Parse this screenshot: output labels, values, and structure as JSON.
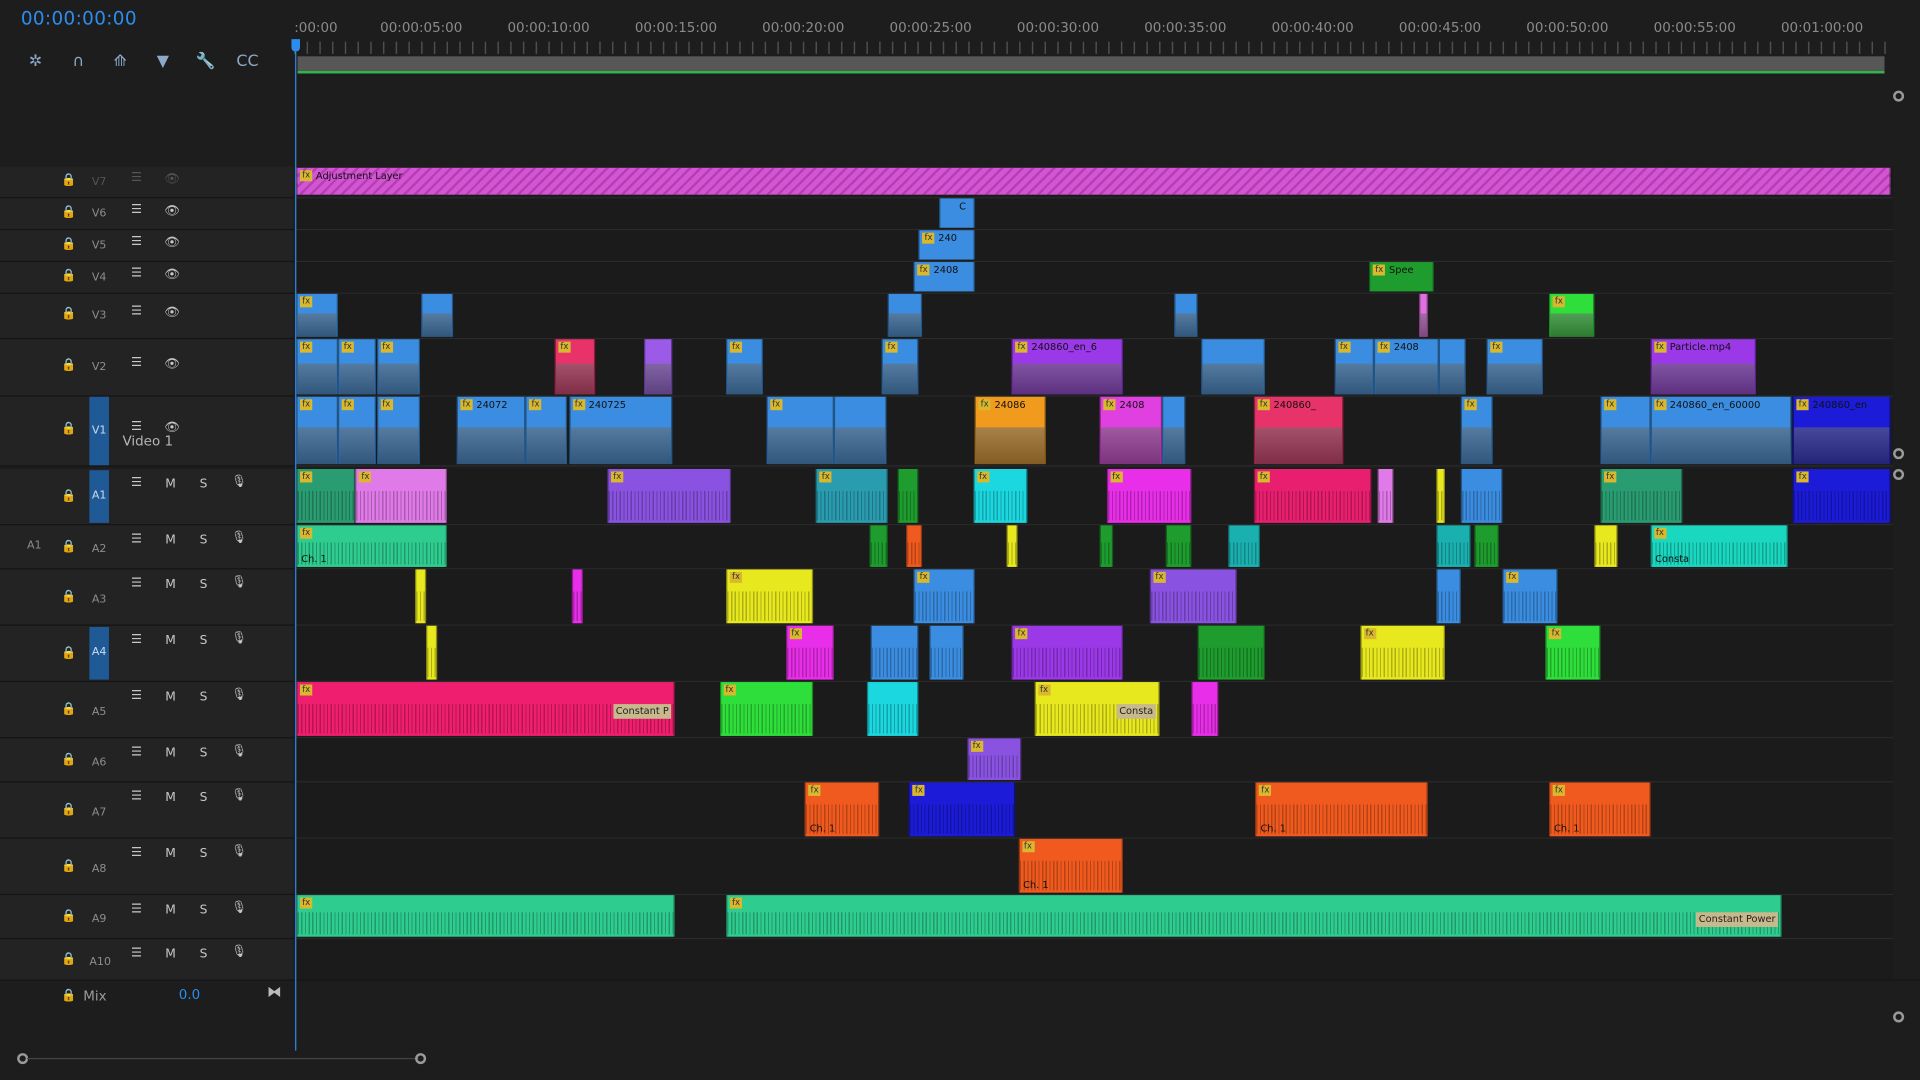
{
  "timecode": "00:00:00:00",
  "tools": [
    {
      "name": "snap-icon",
      "glyph": "✲"
    },
    {
      "name": "magnet-icon",
      "glyph": "∩"
    },
    {
      "name": "linked-selection-icon",
      "glyph": "⟰"
    },
    {
      "name": "marker-icon",
      "glyph": "▼"
    },
    {
      "name": "wrench-icon",
      "glyph": "🔧"
    },
    {
      "name": "captions-icon",
      "glyph": "CC"
    }
  ],
  "ruler_labels": [
    ":00:00",
    "00:00:05:00",
    "00:00:10:00",
    "00:00:15:00",
    "00:00:20:00",
    "00:00:25:00",
    "00:00:30:00",
    "00:00:35:00",
    "00:00:40:00",
    "00:00:45:00",
    "00:00:50:00",
    "00:00:55:00",
    "00:01:00:00"
  ],
  "video_tracks": [
    {
      "id": "V7",
      "label": "",
      "target": false
    },
    {
      "id": "V6",
      "label": "",
      "target": false
    },
    {
      "id": "V5",
      "label": "",
      "target": false
    },
    {
      "id": "V4",
      "label": "",
      "target": false
    },
    {
      "id": "V3",
      "label": "",
      "target": false
    },
    {
      "id": "V2",
      "label": "",
      "target": false
    },
    {
      "id": "V1",
      "label": "Video 1",
      "target": true
    }
  ],
  "audio_tracks": [
    {
      "id": "A1",
      "source": "",
      "target": true
    },
    {
      "id": "A2",
      "source": "A1",
      "target": false
    },
    {
      "id": "A3",
      "source": "",
      "target": false
    },
    {
      "id": "A4",
      "source": "",
      "target": true
    },
    {
      "id": "A5",
      "source": "",
      "target": false
    },
    {
      "id": "A6",
      "source": "",
      "target": false
    },
    {
      "id": "A7",
      "source": "",
      "target": false
    },
    {
      "id": "A8",
      "source": "",
      "target": false
    },
    {
      "id": "A9",
      "source": "",
      "target": false
    },
    {
      "id": "A10",
      "source": "",
      "target": false
    }
  ],
  "mix": {
    "label": "Mix",
    "value": "0.0"
  },
  "header_glyphs": {
    "mute": "M",
    "solo": "S",
    "eye": "👁",
    "sync": "☰",
    "mic": "🎙",
    "lock": "🔒"
  },
  "clips": [
    {
      "track": "V7",
      "start": 0.0,
      "end": 99.4,
      "color": "#d455d4",
      "label": "Adjustment Layer",
      "fx": true,
      "hatched": true
    },
    {
      "track": "V6",
      "start": 40.1,
      "end": 42.3,
      "color": "#3a8de0",
      "label": "C",
      "fx": false
    },
    {
      "track": "V5",
      "start": 38.8,
      "end": 42.3,
      "color": "#3a8de0",
      "label": "240",
      "fx": true
    },
    {
      "track": "V4",
      "start": 38.5,
      "end": 42.3,
      "color": "#3a8de0",
      "label": "2408",
      "fx": true
    },
    {
      "track": "V4",
      "start": 66.9,
      "end": 70.9,
      "color": "#1e9c2d",
      "label": "Spee",
      "fx": true
    },
    {
      "track": "V3",
      "start": 0.0,
      "end": 2.6,
      "color": "#3a8de0",
      "label": "",
      "fx": true
    },
    {
      "track": "V3",
      "start": 7.8,
      "end": 9.8,
      "color": "#3a8de0",
      "label": "",
      "fx": false
    },
    {
      "track": "V3",
      "start": 36.9,
      "end": 39.0,
      "color": "#3a8de0",
      "label": "",
      "fx": false
    },
    {
      "track": "V3",
      "start": 54.7,
      "end": 56.2,
      "color": "#3a8de0",
      "label": "",
      "fx": false
    },
    {
      "track": "V3",
      "start": 70.0,
      "end": 70.5,
      "color": "#e070e0",
      "label": "",
      "fx": false
    },
    {
      "track": "V3",
      "start": 78.1,
      "end": 80.9,
      "color": "#2ede3a",
      "label": "",
      "fx": true
    },
    {
      "track": "V2",
      "start": 0.0,
      "end": 2.6,
      "color": "#3a8de0",
      "label": "",
      "fx": true
    },
    {
      "track": "V2",
      "start": 2.6,
      "end": 5.0,
      "color": "#3a8de0",
      "label": "",
      "fx": true
    },
    {
      "track": "V2",
      "start": 5.0,
      "end": 7.7,
      "color": "#3a8de0",
      "label": "",
      "fx": true
    },
    {
      "track": "V2",
      "start": 16.1,
      "end": 18.6,
      "color": "#e8336a",
      "label": "",
      "fx": true
    },
    {
      "track": "V2",
      "start": 21.7,
      "end": 23.4,
      "color": "#9b5be8",
      "label": "",
      "fx": false
    },
    {
      "track": "V2",
      "start": 26.8,
      "end": 29.1,
      "color": "#3a8de0",
      "label": "",
      "fx": true
    },
    {
      "track": "V2",
      "start": 36.5,
      "end": 38.8,
      "color": "#3a8de0",
      "label": "",
      "fx": true
    },
    {
      "track": "V2",
      "start": 44.6,
      "end": 51.5,
      "color": "#9b38e8",
      "label": "240860_en_6",
      "fx": true
    },
    {
      "track": "V2",
      "start": 56.4,
      "end": 60.4,
      "color": "#3a8de0",
      "label": "",
      "fx": false
    },
    {
      "track": "V2",
      "start": 64.7,
      "end": 67.2,
      "color": "#3a8de0",
      "label": "",
      "fx": true
    },
    {
      "track": "V2",
      "start": 67.2,
      "end": 71.2,
      "color": "#3a8de0",
      "label": "2408",
      "fx": true
    },
    {
      "track": "V2",
      "start": 71.2,
      "end": 72.9,
      "color": "#3a8de0",
      "label": "",
      "fx": false
    },
    {
      "track": "V2",
      "start": 74.2,
      "end": 77.7,
      "color": "#3a8de0",
      "label": "",
      "fx": true
    },
    {
      "track": "V2",
      "start": 84.4,
      "end": 91.0,
      "color": "#9b38e8",
      "label": "Particle.mp4",
      "fx": true
    },
    {
      "track": "V1",
      "start": 0.0,
      "end": 2.6,
      "color": "#3a8de0",
      "label": "",
      "fx": true
    },
    {
      "track": "V1",
      "start": 2.6,
      "end": 5.0,
      "color": "#3a8de0",
      "label": "",
      "fx": true
    },
    {
      "track": "V1",
      "start": 5.0,
      "end": 7.7,
      "color": "#3a8de0",
      "label": "",
      "fx": true
    },
    {
      "track": "V1",
      "start": 10.0,
      "end": 14.3,
      "color": "#3a8de0",
      "label": "24072",
      "fx": true
    },
    {
      "track": "V1",
      "start": 14.3,
      "end": 16.9,
      "color": "#3a8de0",
      "label": "",
      "fx": true
    },
    {
      "track": "V1",
      "start": 17.0,
      "end": 23.4,
      "color": "#3a8de0",
      "label": "240725",
      "fx": true
    },
    {
      "track": "V1",
      "start": 29.3,
      "end": 33.5,
      "color": "#3a8de0",
      "label": "",
      "fx": true
    },
    {
      "track": "V1",
      "start": 33.5,
      "end": 36.8,
      "color": "#3a8de0",
      "label": "",
      "fx": false
    },
    {
      "track": "V1",
      "start": 42.3,
      "end": 46.7,
      "color": "#f09b1d",
      "label": "24086",
      "fx": true
    },
    {
      "track": "V1",
      "start": 50.1,
      "end": 54.0,
      "color": "#e040e0",
      "label": "2408",
      "fx": true
    },
    {
      "track": "V1",
      "start": 54.0,
      "end": 55.4,
      "color": "#3a8de0",
      "label": "",
      "fx": false
    },
    {
      "track": "V1",
      "start": 59.7,
      "end": 65.3,
      "color": "#e8336a",
      "label": "240860_",
      "fx": true
    },
    {
      "track": "V1",
      "start": 72.6,
      "end": 74.6,
      "color": "#3a8de0",
      "label": "",
      "fx": true
    },
    {
      "track": "V1",
      "start": 81.3,
      "end": 84.4,
      "color": "#3a8de0",
      "label": "",
      "fx": true
    },
    {
      "track": "V1",
      "start": 84.4,
      "end": 93.2,
      "color": "#3a8de0",
      "label": "240860_en_60000",
      "fx": true
    },
    {
      "track": "V1",
      "start": 93.3,
      "end": 99.4,
      "color": "#1b1bd8",
      "label": "240860_en",
      "fx": true
    },
    {
      "track": "A1",
      "start": 0.0,
      "end": 3.7,
      "color": "#2a9c72",
      "label": "",
      "fx": true
    },
    {
      "track": "A1",
      "start": 3.7,
      "end": 9.4,
      "color": "#e07ae8",
      "label": "",
      "fx": true
    },
    {
      "track": "A1",
      "start": 19.4,
      "end": 27.1,
      "color": "#8a52e0",
      "label": "",
      "fx": true
    },
    {
      "track": "A1",
      "start": 32.4,
      "end": 36.9,
      "color": "#2a9cb0",
      "label": "",
      "fx": true
    },
    {
      "track": "A1",
      "start": 37.5,
      "end": 38.8,
      "color": "#1e9c2d",
      "label": "",
      "fx": false
    },
    {
      "track": "A1",
      "start": 42.2,
      "end": 45.6,
      "color": "#1ad7e0",
      "label": "",
      "fx": true
    },
    {
      "track": "A1",
      "start": 50.5,
      "end": 55.8,
      "color": "#e82ee8",
      "label": "",
      "fx": true
    },
    {
      "track": "A1",
      "start": 59.7,
      "end": 67.0,
      "color": "#e81e6e",
      "label": "",
      "fx": true
    },
    {
      "track": "A1",
      "start": 67.4,
      "end": 68.4,
      "color": "#e07ae8",
      "label": "",
      "fx": false
    },
    {
      "track": "A1",
      "start": 71.1,
      "end": 71.6,
      "color": "#e8e81e",
      "label": "",
      "fx": false
    },
    {
      "track": "A1",
      "start": 72.6,
      "end": 75.2,
      "color": "#3a8de0",
      "label": "",
      "fx": false
    },
    {
      "track": "A1",
      "start": 81.3,
      "end": 86.4,
      "color": "#2a9c72",
      "label": "",
      "fx": true
    },
    {
      "track": "A1",
      "start": 93.3,
      "end": 99.4,
      "color": "#1b1bd8",
      "label": "",
      "fx": true
    },
    {
      "track": "A2",
      "start": 0.0,
      "end": 9.4,
      "color": "#2ecc8e",
      "label": "Ch. 1",
      "fx": true
    },
    {
      "track": "A2",
      "start": 35.7,
      "end": 36.9,
      "color": "#1e9c2d",
      "label": "",
      "fx": false
    },
    {
      "track": "A2",
      "start": 38.0,
      "end": 39.0,
      "color": "#f05a1e",
      "label": "",
      "fx": false
    },
    {
      "track": "A2",
      "start": 44.3,
      "end": 45.0,
      "color": "#e8e81e",
      "label": "",
      "fx": false
    },
    {
      "track": "A2",
      "start": 50.1,
      "end": 50.9,
      "color": "#1e9c2d",
      "label": "",
      "fx": false
    },
    {
      "track": "A2",
      "start": 54.2,
      "end": 55.8,
      "color": "#1e9c2d",
      "label": "",
      "fx": false
    },
    {
      "track": "A2",
      "start": 58.1,
      "end": 60.1,
      "color": "#1ab0b0",
      "label": "",
      "fx": false
    },
    {
      "track": "A2",
      "start": 71.1,
      "end": 73.2,
      "color": "#1ab0b0",
      "label": "",
      "fx": false
    },
    {
      "track": "A2",
      "start": 73.4,
      "end": 75.0,
      "color": "#1e9c2d",
      "label": "",
      "fx": false
    },
    {
      "track": "A2",
      "start": 80.9,
      "end": 82.4,
      "color": "#e8e81e",
      "label": "",
      "fx": false
    },
    {
      "track": "A2",
      "start": 84.4,
      "end": 93.0,
      "color": "#1ad7c0",
      "label": "Consta",
      "fx": true
    },
    {
      "track": "A3",
      "start": 7.4,
      "end": 8.1,
      "color": "#e8e81e",
      "label": "",
      "fx": false
    },
    {
      "track": "A3",
      "start": 17.2,
      "end": 17.9,
      "color": "#e82ee8",
      "label": "",
      "fx": false
    },
    {
      "track": "A3",
      "start": 26.8,
      "end": 32.2,
      "color": "#e8e81e",
      "label": "",
      "fx": true
    },
    {
      "track": "A3",
      "start": 38.5,
      "end": 42.3,
      "color": "#3a8de0",
      "label": "",
      "fx": true
    },
    {
      "track": "A3",
      "start": 53.2,
      "end": 58.6,
      "color": "#8a52e0",
      "label": "",
      "fx": true
    },
    {
      "track": "A3",
      "start": 71.1,
      "end": 72.6,
      "color": "#3a8de0",
      "label": "",
      "fx": false
    },
    {
      "track": "A3",
      "start": 75.2,
      "end": 78.6,
      "color": "#3a8de0",
      "label": "",
      "fx": true
    },
    {
      "track": "A4",
      "start": 8.1,
      "end": 8.8,
      "color": "#e8e81e",
      "label": "",
      "fx": false
    },
    {
      "track": "A4",
      "start": 30.5,
      "end": 33.5,
      "color": "#e82ee8",
      "label": "",
      "fx": true
    },
    {
      "track": "A4",
      "start": 35.8,
      "end": 38.8,
      "color": "#3a8de0",
      "label": "",
      "fx": false
    },
    {
      "track": "A4",
      "start": 39.5,
      "end": 41.6,
      "color": "#3a8de0",
      "label": "",
      "fx": false
    },
    {
      "track": "A4",
      "start": 44.6,
      "end": 51.5,
      "color": "#9b38e8",
      "label": "",
      "fx": true
    },
    {
      "track": "A4",
      "start": 56.2,
      "end": 60.4,
      "color": "#1e9c2d",
      "label": "",
      "fx": false
    },
    {
      "track": "A4",
      "start": 66.3,
      "end": 71.6,
      "color": "#e8e81e",
      "label": "",
      "fx": true
    },
    {
      "track": "A4",
      "start": 77.9,
      "end": 81.3,
      "color": "#2ede3a",
      "label": "",
      "fx": true
    },
    {
      "track": "A5",
      "start": 0.0,
      "end": 23.6,
      "color": "#f01e6e",
      "label": "Constant P",
      "fx": true,
      "tagged": true
    },
    {
      "track": "A5",
      "start": 26.4,
      "end": 32.2,
      "color": "#2ede3a",
      "label": "",
      "fx": true
    },
    {
      "track": "A5",
      "start": 35.6,
      "end": 38.8,
      "color": "#1ad7e0",
      "label": "",
      "fx": false
    },
    {
      "track": "A5",
      "start": 46.0,
      "end": 53.8,
      "color": "#e8e81e",
      "label": "Consta",
      "fx": true,
      "tagged": true
    },
    {
      "track": "A5",
      "start": 55.8,
      "end": 57.5,
      "color": "#e82ee8",
      "label": "",
      "fx": false
    },
    {
      "track": "A6",
      "start": 41.8,
      "end": 45.2,
      "color": "#8a52e0",
      "label": "",
      "fx": true
    },
    {
      "track": "A7",
      "start": 31.7,
      "end": 36.3,
      "color": "#f05a1e",
      "label": "Ch. 1",
      "fx": true
    },
    {
      "track": "A7",
      "start": 38.2,
      "end": 44.8,
      "color": "#1b1bd8",
      "label": "",
      "fx": true
    },
    {
      "track": "A7",
      "start": 59.8,
      "end": 70.5,
      "color": "#f05a1e",
      "label": "Ch. 1",
      "fx": true
    },
    {
      "track": "A7",
      "start": 78.1,
      "end": 84.4,
      "color": "#f05a1e",
      "label": "Ch. 1",
      "fx": true
    },
    {
      "track": "A8",
      "start": 45.0,
      "end": 51.5,
      "color": "#f05a1e",
      "label": "Ch. 1",
      "fx": true
    },
    {
      "track": "A9",
      "start": 0.0,
      "end": 23.6,
      "color": "#2ecc8e",
      "label": "",
      "fx": true
    },
    {
      "track": "A9",
      "start": 26.8,
      "end": 92.6,
      "color": "#2ecc8e",
      "label": "Constant Power",
      "fx": true,
      "tagged": true
    }
  ]
}
